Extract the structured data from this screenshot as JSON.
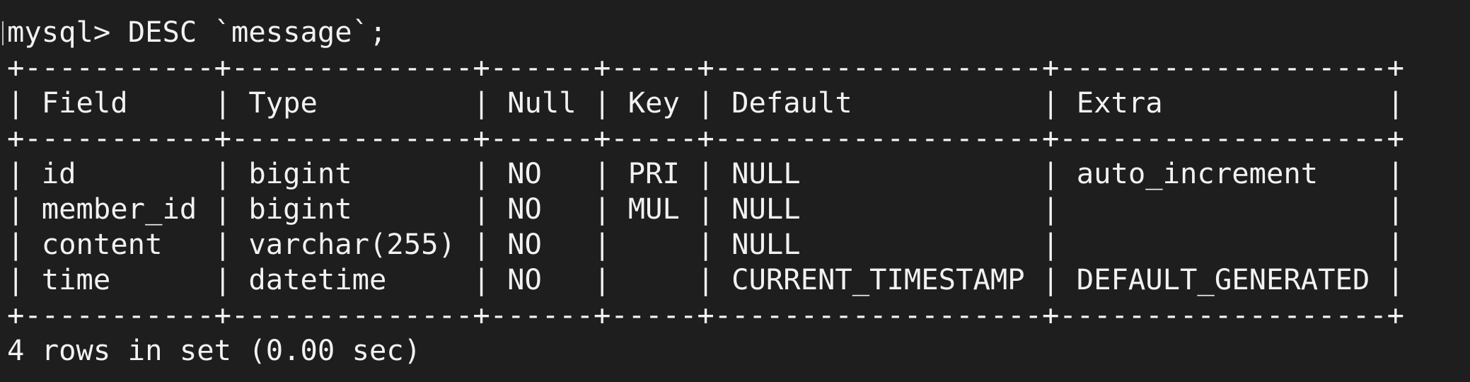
{
  "terminal": {
    "prompt": "mysql>",
    "command": "DESC `message`;",
    "table": {
      "border": "+-----------+--------------+------+-----+-------------------+-------------------+",
      "header_row": "| Field     | Type         | Null | Key | Default           | Extra             |",
      "rows": [
        "| id        | bigint       | NO   | PRI | NULL              | auto_increment    |",
        "| member_id | bigint       | NO   | MUL | NULL              |                   |",
        "| content   | varchar(255) | NO   |     | NULL              |                   |",
        "| time      | datetime     | NO   |     | CURRENT_TIMESTAMP | DEFAULT_GENERATED |"
      ]
    },
    "summary": "4 rows in set (0.00 sec)"
  }
}
